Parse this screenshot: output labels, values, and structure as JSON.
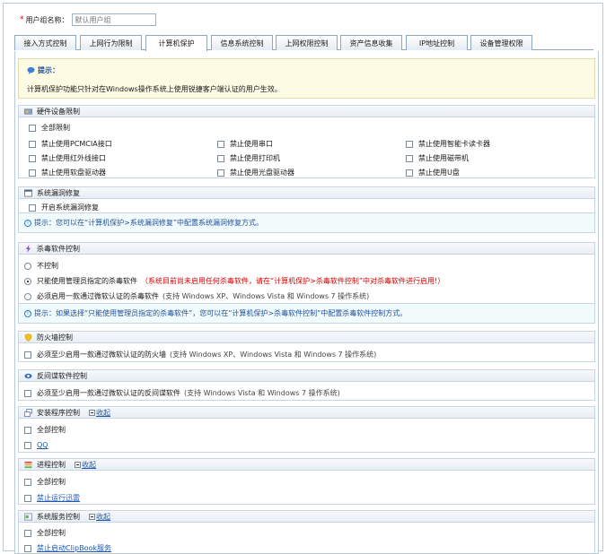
{
  "group_name": {
    "required_mark": "*",
    "label": "用户组名称：",
    "placeholder": "默认用户组"
  },
  "tabs": [
    {
      "label": "接入方式控制"
    },
    {
      "label": "上网行为限制"
    },
    {
      "label": "计算机保护",
      "active": true
    },
    {
      "label": "信息系统控制"
    },
    {
      "label": "上网权限控制"
    },
    {
      "label": "资产信息收集"
    },
    {
      "label": "IP地址控制"
    },
    {
      "label": "设备管理权限"
    }
  ],
  "tip": {
    "title": "提示：",
    "text": "计算机保护功能只针对在Windows操作系统上使用锐捷客户端认证的用户生效。"
  },
  "hardware": {
    "title": "硬件设备限制",
    "all": "全部限制",
    "items": [
      "禁止使用PCMCIA接口",
      "禁止使用串口",
      "禁止使用智能卡读卡器",
      "禁止使用红外线接口",
      "禁止使用打印机",
      "禁止使用磁带机",
      "禁止使用软盘驱动器",
      "禁止使用光盘驱动器",
      "禁止使用U盘"
    ]
  },
  "patch": {
    "title": "系统漏洞修复",
    "item": "开启系统漏洞修复",
    "note": "提示：您可以在“计算机保护>系统漏洞修复”中配置系统漏洞修复方式。"
  },
  "antivirus": {
    "title": "杀毒软件控制",
    "opt1": "不控制",
    "opt2": "只能使用管理员指定的杀毒软件",
    "opt2_warn": "（系统目前尚未启用任何杀毒软件，请在“计算机保护>杀毒软件控制”中对杀毒软件进行启用!）",
    "opt3": "必须启用一款通过微软认证的杀毒软件",
    "opt3_hint": "(支持 Windows XP、Windows Vista 和 Windows 7 操作系统)",
    "note": "提示：如果选择“只能使用管理员指定的杀毒软件”，您可以在“计算机保护>杀毒软件控制”中配置杀毒软件控制方式。"
  },
  "firewall": {
    "title": "防火墙控制",
    "item": "必须至少启用一款通过微软认证的防火墙",
    "hint": "(支持 Windows XP、Windows Vista 和 Windows 7 操作系统)"
  },
  "antispy": {
    "title": "反间谍软件控制",
    "item": "必须至少启用一款通过微软认证的反间谍软件",
    "hint": "(支持 Windows Vista 和 Windows 7 操作系统)"
  },
  "install": {
    "title": "安装程序控制",
    "collapse": "收起",
    "all": "全部控制",
    "item": "QQ"
  },
  "process": {
    "title": "进程控制",
    "collapse": "收起",
    "all": "全部控制",
    "item": "禁止运行迅雷"
  },
  "service": {
    "title": "系统服务控制",
    "collapse": "收起",
    "all": "全部控制",
    "item": "禁止启动ClipBook服务"
  },
  "colors": {
    "accent": "#1e4f9e",
    "warn": "#d40000",
    "link": "#1d57b4"
  }
}
